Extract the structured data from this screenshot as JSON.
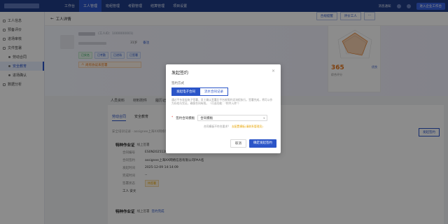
{
  "topnav": {
    "items": [
      "工作台",
      "工人管理",
      "班组管理",
      "考勤管理",
      "结算管理",
      "项目设置"
    ],
    "active_index": 1
  },
  "topright": {
    "notice": "消息通知",
    "enter": "进入企业工作台"
  },
  "sidebar": {
    "items": [
      {
        "label": "工人信息",
        "level": 0
      },
      {
        "label": "预备评价",
        "level": 0
      },
      {
        "label": "进场审核",
        "level": 0
      },
      {
        "label": "文件签署",
        "level": 0
      },
      {
        "label": "劳动合同",
        "level": 1
      },
      {
        "label": "安全教育",
        "level": 1,
        "selected": true
      },
      {
        "label": "进场确认",
        "level": 1
      },
      {
        "label": "数据分析",
        "level": 0
      }
    ]
  },
  "breadcrumb": {
    "back": "←",
    "title": "工人详情"
  },
  "profile": {
    "id_text": "(工人ID：1000000001)",
    "meta": [
      "31岁",
      "备注"
    ],
    "tags": [
      "已实名",
      "已考勤",
      "已进场",
      "已签署"
    ],
    "warning": "尚有协议未签署",
    "buttons": [
      "合规提醒",
      "评价工人",
      "···"
    ],
    "score": "365",
    "score_label": "综合评分",
    "level": "优良"
  },
  "tabs_primary": [
    "人员资料",
    "材料附件",
    "履历记录"
  ],
  "tabs_secondary": [
    "劳动合同",
    "安全教育"
  ],
  "section_sub": "安全培训记录 · assignee上海XX网络信息有限公司",
  "sign_button": "发起签约",
  "record1": {
    "title": "特种作业证",
    "status": "线上签署",
    "rows": [
      {
        "k": "合同编号",
        "v": "ES0N2025120905dGF"
      },
      {
        "k": "合同签约",
        "v": "assignee上海XX网络信息有限公司PAA名"
      },
      {
        "k": "发起时间",
        "v": "2025-12-09 14:14:09"
      },
      {
        "k": "完成时间",
        "v": "--"
      }
    ],
    "badge_key": "签署状态",
    "badge": "待签署",
    "signer": "工人 安文"
  },
  "record2": {
    "title": "特种作业证",
    "status": "线上签署",
    "status2": "签约完成"
  },
  "modal": {
    "title": "发起签约",
    "close": "×",
    "method_label": "签约方式",
    "options": [
      "发起电子合同",
      "流水合同记录"
    ],
    "selected_option": 0,
    "description": "通过平台发起电子签署，员工确认签署后平台按照约定流程执行。签署完成，将可以作为存档与凭证，确保合同有效。（可选功能：“附件入库”）",
    "template_label": "签约合同模板",
    "template_value": "合同模板",
    "hint_text": "合同模板不符合要求？",
    "hint_link": "去配置模板(请联系管理员)",
    "cancel": "取消",
    "confirm": "确定发起签约"
  }
}
